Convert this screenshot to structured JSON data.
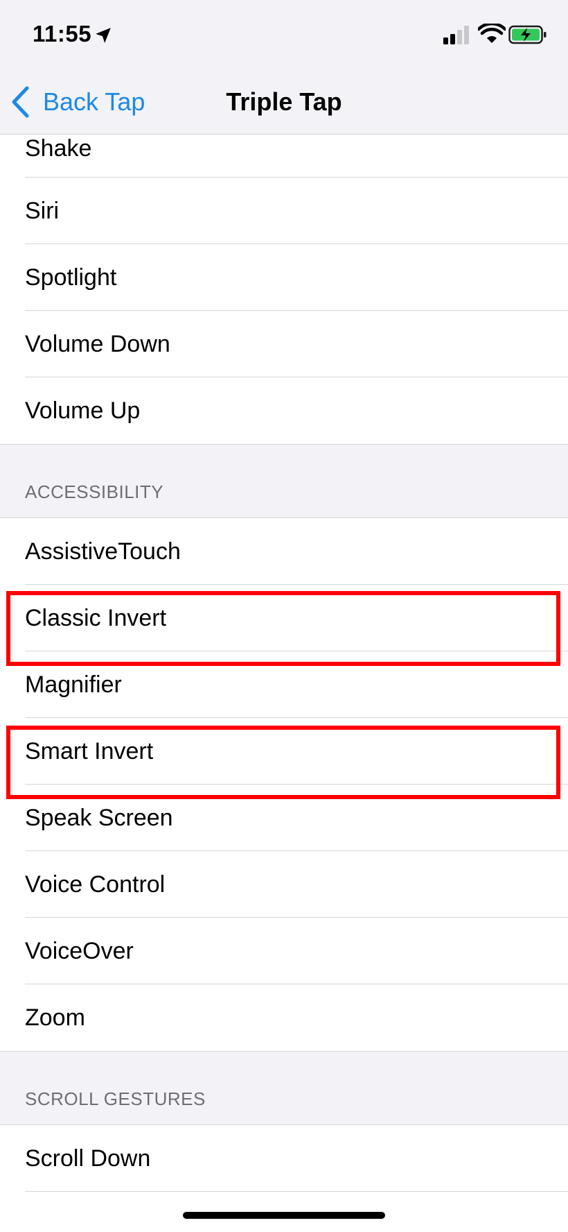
{
  "status_bar": {
    "time": "11:55",
    "icons": [
      "location-arrow-icon",
      "cellular-signal-icon",
      "wifi-icon",
      "battery-charging-icon"
    ]
  },
  "nav": {
    "back_label": "Back Tap",
    "title": "Triple Tap",
    "accent_color": "#1e88e5"
  },
  "system_items": [
    {
      "label": "Shake"
    },
    {
      "label": "Siri"
    },
    {
      "label": "Spotlight"
    },
    {
      "label": "Volume Down"
    },
    {
      "label": "Volume Up"
    }
  ],
  "accessibility": {
    "header": "ACCESSIBILITY",
    "items": [
      {
        "label": "AssistiveTouch"
      },
      {
        "label": "Classic Invert"
      },
      {
        "label": "Magnifier"
      },
      {
        "label": "Smart Invert"
      },
      {
        "label": "Speak Screen"
      },
      {
        "label": "Voice Control"
      },
      {
        "label": "VoiceOver"
      },
      {
        "label": "Zoom"
      }
    ]
  },
  "scroll_gestures": {
    "header": "SCROLL GESTURES",
    "items": [
      {
        "label": "Scroll Down"
      }
    ]
  },
  "highlight_color": "#ff0000"
}
